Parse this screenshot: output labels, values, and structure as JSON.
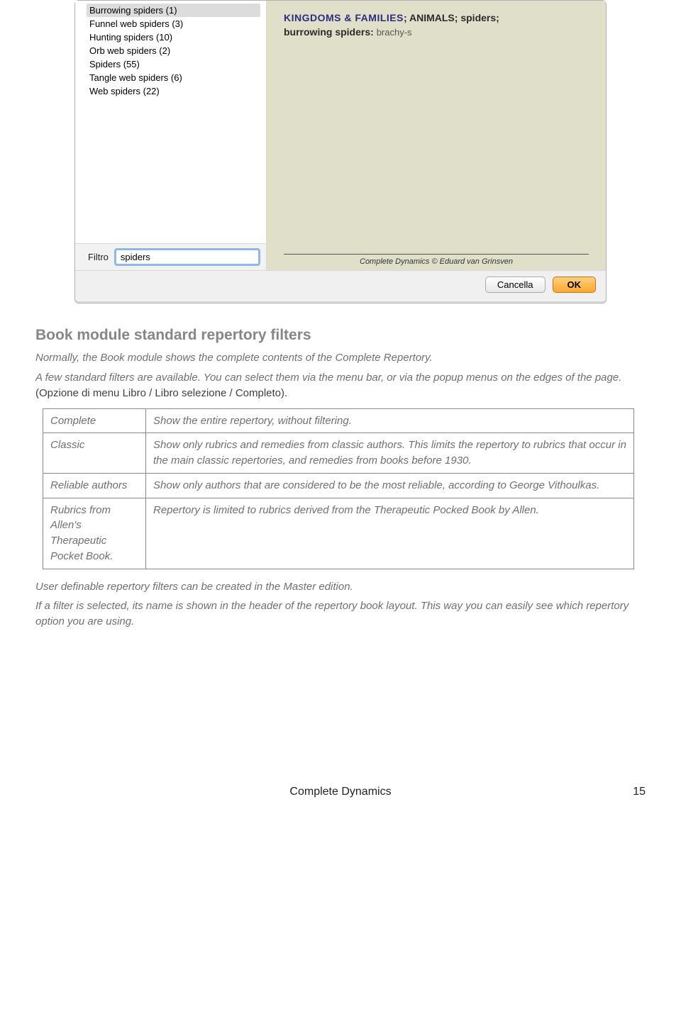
{
  "dialog": {
    "list": [
      "Burrowing spiders (1)",
      "Funnel web spiders (3)",
      "Hunting spiders (10)",
      "Orb web spiders (2)",
      "Spiders (55)",
      "Tangle web spiders (6)",
      "Web spiders (22)"
    ],
    "filter_label": "Filtro",
    "filter_value": "spiders",
    "rubric_kf": "KINGDOMS & FAMILIES",
    "rubric_animals": "ANIMALS",
    "rubric_spiders": "spiders",
    "rubric_line2_bold": "burrowing spiders:",
    "rubric_line2_rest": "brachy-s",
    "copyright": "Complete Dynamics © Eduard van Grinsven",
    "cancel_label": "Cancella",
    "ok_label": "OK"
  },
  "article": {
    "heading": "Book module standard repertory filters",
    "p1": "Normally, the Book module shows the complete contents of the Complete Repertory.",
    "p2a": "A few standard filters are available. You can select them via the menu bar, or via the popup menus on the edges of the page. ",
    "p2b_menu": "(Opzione di menu Libro / Libro selezione / Completo).",
    "table": [
      {
        "k": "Complete",
        "v": "Show the entire repertory, without filtering."
      },
      {
        "k": "Classic",
        "v": "Show only rubrics and remedies from classic authors. This limits the repertory to rubrics that occur in the main classic repertories, and remedies from books before 1930."
      },
      {
        "k": "Reliable authors",
        "v": "Show only authors that are considered to be the most reliable, according to George Vithoulkas."
      },
      {
        "k": "Rubrics from Allen's Therapeutic Pocket Book.",
        "v": "Repertory is limited to rubrics derived from the Therapeutic Pocked Book by Allen."
      }
    ],
    "p3": "User definable repertory filters can be created in the Master edition.",
    "p4": "If a filter is selected, its name is shown in the header of the repertory book layout. This way you can easily see which repertory option you are using."
  },
  "footer": {
    "title": "Complete Dynamics",
    "page": "15"
  }
}
